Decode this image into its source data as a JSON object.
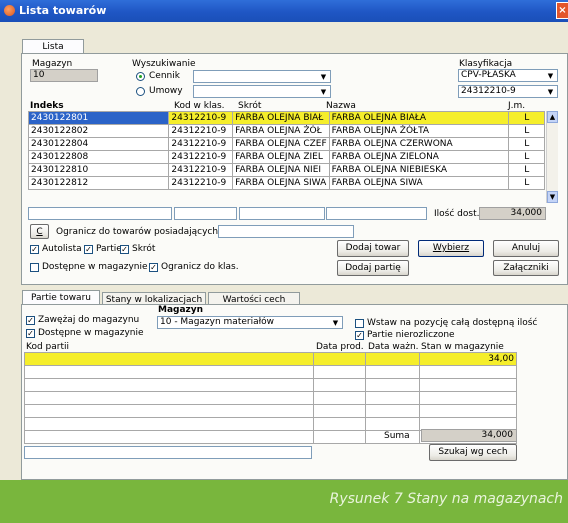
{
  "window": {
    "title": "Lista towarów",
    "close_glyph": "×"
  },
  "main_tab": "Lista towarów",
  "magazyn": {
    "label": "Magazyn",
    "value": "10"
  },
  "wyszukiwanie": {
    "label": "Wyszukiwanie",
    "options": [
      {
        "label": "Cennik",
        "selected": true
      },
      {
        "label": "Umowy",
        "selected": false
      }
    ]
  },
  "klasyfikacja": {
    "label": "Klasyfikacja",
    "value1": "CPV-PŁASKA",
    "value2": "24312210-9"
  },
  "columns": {
    "indeks": "Indeks",
    "kod": "Kod w klas.",
    "skrot": "Skrót",
    "nazwa": "Nazwa",
    "jm": "J.m."
  },
  "rows": [
    {
      "indeks": "2430122801",
      "kod": "24312210-9",
      "skrot": "FARBA OLEJNA BIAŁ",
      "nazwa": "FARBA OLEJNA BIAŁA",
      "jm": "L",
      "selected": true
    },
    {
      "indeks": "2430122802",
      "kod": "24312210-9",
      "skrot": "FARBA OLEJNA ŻÓŁ",
      "nazwa": "FARBA OLEJNA ŻÓŁTA",
      "jm": "L",
      "selected": false
    },
    {
      "indeks": "2430122804",
      "kod": "24312210-9",
      "skrot": "FARBA OLEJNA CZEF",
      "nazwa": "FARBA OLEJNA CZERWONA",
      "jm": "L",
      "selected": false
    },
    {
      "indeks": "2430122808",
      "kod": "24312210-9",
      "skrot": "FARBA OLEJNA ZIEL",
      "nazwa": "FARBA OLEJNA ZIELONA",
      "jm": "L",
      "selected": false
    },
    {
      "indeks": "2430122810",
      "kod": "24312210-9",
      "skrot": "FARBA OLEJNA NIEI",
      "nazwa": "FARBA OLEJNA NIEBIESKA",
      "jm": "L",
      "selected": false
    },
    {
      "indeks": "2430122812",
      "kod": "24312210-9",
      "skrot": "FARBA OLEJNA SIWA",
      "nazwa": "FARBA OLEJNA SIWA",
      "jm": "L",
      "selected": false
    }
  ],
  "ilosc": {
    "label": "Ilość dost.",
    "value": "34,000"
  },
  "ogranicz": {
    "button": "C",
    "label": "Ogranicz do towarów posiadających partię"
  },
  "checks": {
    "autolista": "Autolista",
    "partie": "Partie",
    "skrot": "Skrót",
    "dostepne": "Dostępne w magazynie",
    "ogranicz_klas": "Ogranicz do klas."
  },
  "buttons": {
    "dodaj_towar": "Dodaj towar",
    "wybierz": "Wybierz",
    "anuluj": "Anuluj",
    "dodaj_partie": "Dodaj partię",
    "zalaczniki": "Załączniki",
    "szukaj": "Szukaj wg cech"
  },
  "subtabs": [
    "Partie towaru",
    "Stany w lokalizacjach",
    "Wartości cech"
  ],
  "partie": {
    "zawezaj": "Zawężaj do magazynu",
    "dostepne": "Dostępne w magazynie",
    "magazyn_label": "Magazyn",
    "magazyn_value": "10 - Magazyn materiałów",
    "wstaw": "Wstaw na pozycję całą dostępną ilość",
    "nierozl": "Partie nierozliczone",
    "columns": {
      "kod": "Kod partii",
      "data_prod": "Data prod.",
      "data_wazn": "Data ważn.",
      "stan": "Stan w magazynie"
    },
    "first_stan": "34,00",
    "suma_label": "Suma",
    "suma_value": "34,000"
  },
  "footer": {
    "caption": "Rysunek 7 Stany na magazynach",
    "color": "#79b63d"
  },
  "colors": {
    "title_bar": "#1f56c4",
    "selection": "#f5ee2b",
    "selected_cell": "#2b63c8"
  }
}
